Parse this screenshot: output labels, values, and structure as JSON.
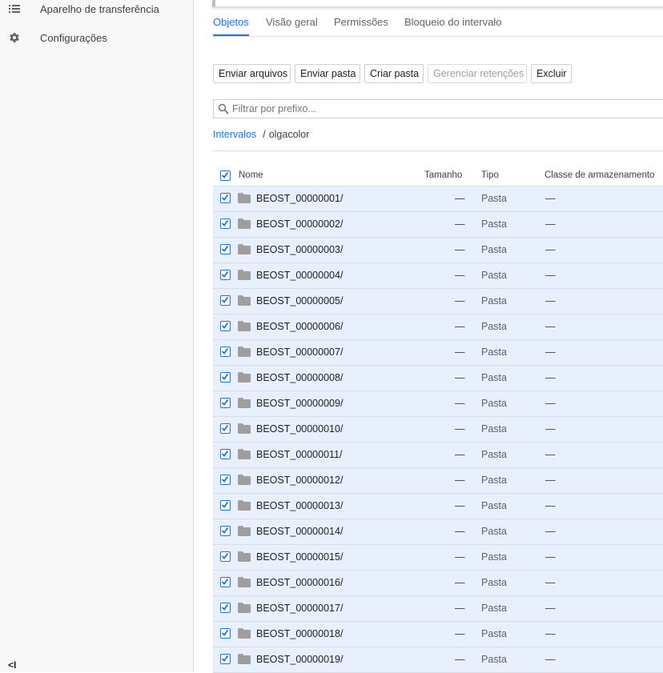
{
  "sidebar": {
    "items": [
      {
        "label": "Aparelho de transferência",
        "icon": "list-icon"
      },
      {
        "label": "Configurações",
        "icon": "gear-icon"
      }
    ],
    "collapse_icon": "collapse-sidebar-icon",
    "collapse_glyph": "<I"
  },
  "tabs": [
    "Objetos",
    "Visão geral",
    "Permissões",
    "Bloqueio do intervalo"
  ],
  "active_tab": "Objetos",
  "toolbar": {
    "upload_files": "Enviar arquivos",
    "upload_folder": "Enviar pasta",
    "create_folder": "Criar pasta",
    "manage_holds": "Gerenciar retenções",
    "delete": "Excluir"
  },
  "filter": {
    "placeholder": "Filtrar por prefixo..."
  },
  "breadcrumb": {
    "root": "Intervalos",
    "separator": "/",
    "current": "olgacolor"
  },
  "table": {
    "columns": {
      "name": "Nome",
      "size": "Tamanho",
      "type": "Tipo",
      "storage_class": "Classe de armazenamento"
    },
    "all_selected": true,
    "rows": [
      {
        "name": "BEOST_00000001/",
        "size": "—",
        "type": "Pasta",
        "storage_class": "—"
      },
      {
        "name": "BEOST_00000002/",
        "size": "—",
        "type": "Pasta",
        "storage_class": "—"
      },
      {
        "name": "BEOST_00000003/",
        "size": "—",
        "type": "Pasta",
        "storage_class": "—"
      },
      {
        "name": "BEOST_00000004/",
        "size": "—",
        "type": "Pasta",
        "storage_class": "—"
      },
      {
        "name": "BEOST_00000005/",
        "size": "—",
        "type": "Pasta",
        "storage_class": "—"
      },
      {
        "name": "BEOST_00000006/",
        "size": "—",
        "type": "Pasta",
        "storage_class": "—"
      },
      {
        "name": "BEOST_00000007/",
        "size": "—",
        "type": "Pasta",
        "storage_class": "—"
      },
      {
        "name": "BEOST_00000008/",
        "size": "—",
        "type": "Pasta",
        "storage_class": "—"
      },
      {
        "name": "BEOST_00000009/",
        "size": "—",
        "type": "Pasta",
        "storage_class": "—"
      },
      {
        "name": "BEOST_00000010/",
        "size": "—",
        "type": "Pasta",
        "storage_class": "—"
      },
      {
        "name": "BEOST_00000011/",
        "size": "—",
        "type": "Pasta",
        "storage_class": "—"
      },
      {
        "name": "BEOST_00000012/",
        "size": "—",
        "type": "Pasta",
        "storage_class": "—"
      },
      {
        "name": "BEOST_00000013/",
        "size": "—",
        "type": "Pasta",
        "storage_class": "—"
      },
      {
        "name": "BEOST_00000014/",
        "size": "—",
        "type": "Pasta",
        "storage_class": "—"
      },
      {
        "name": "BEOST_00000015/",
        "size": "—",
        "type": "Pasta",
        "storage_class": "—"
      },
      {
        "name": "BEOST_00000016/",
        "size": "—",
        "type": "Pasta",
        "storage_class": "—"
      },
      {
        "name": "BEOST_00000017/",
        "size": "—",
        "type": "Pasta",
        "storage_class": "—"
      },
      {
        "name": "BEOST_00000018/",
        "size": "—",
        "type": "Pasta",
        "storage_class": "—"
      },
      {
        "name": "BEOST_00000019/",
        "size": "—",
        "type": "Pasta",
        "storage_class": "—"
      }
    ]
  },
  "colors": {
    "accent": "#1a73e8",
    "row_selected": "#e8f0fe",
    "folder": "#9e9e9e"
  }
}
